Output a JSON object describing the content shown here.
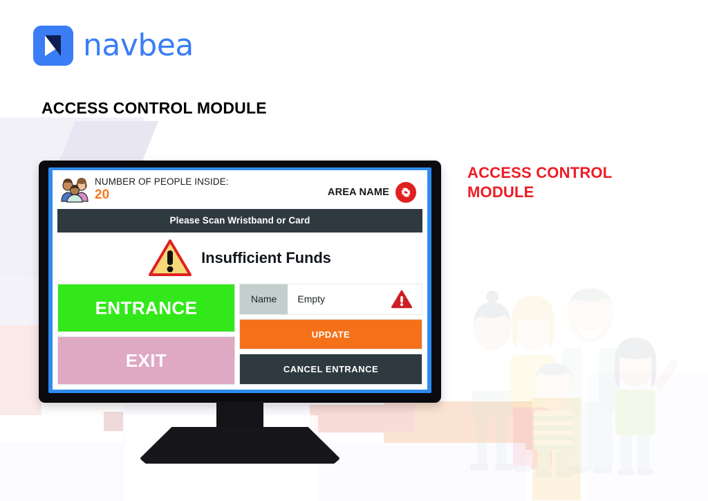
{
  "brand": {
    "name": "navbea",
    "logo_icon": "navbea-arrow-mark",
    "accent_color": "#3b7df5"
  },
  "page": {
    "title": "ACCESS CONTROL MODULE"
  },
  "caption": {
    "line1": "ACCESS CONTROL",
    "line2": "MODULE",
    "color": "#ed1c24"
  },
  "screen": {
    "status_bar": {
      "people_icon": "family-group-icon",
      "people_label": "NUMBER OF PEOPLE INSIDE:",
      "people_count": "20",
      "people_count_color": "#f47920",
      "area_name": "AREA NAME",
      "area_icon": "refresh-circle-icon",
      "area_icon_color": "#e02020"
    },
    "scan_bar": {
      "text": "Please Scan Wristband or Card",
      "bg_color": "#2f3a40"
    },
    "alert": {
      "icon": "warning-triangle-icon",
      "message": "Insufficient Funds"
    },
    "buttons": {
      "entrance": {
        "label": "ENTRANCE",
        "color": "#33e81a"
      },
      "exit": {
        "label": "EXIT",
        "color": "#dfa8c3"
      },
      "update": {
        "label": "UPDATE",
        "color": "#f4711a"
      },
      "cancel_entrance": {
        "label": "CANCEL ENTRANCE",
        "color": "#2f3a40"
      }
    },
    "name_field": {
      "label": "Name",
      "value": "Empty",
      "placeholder": "Empty",
      "warning_icon": "warning-triangle-icon"
    }
  },
  "illustration": {
    "name": "family-of-five-illustration"
  }
}
